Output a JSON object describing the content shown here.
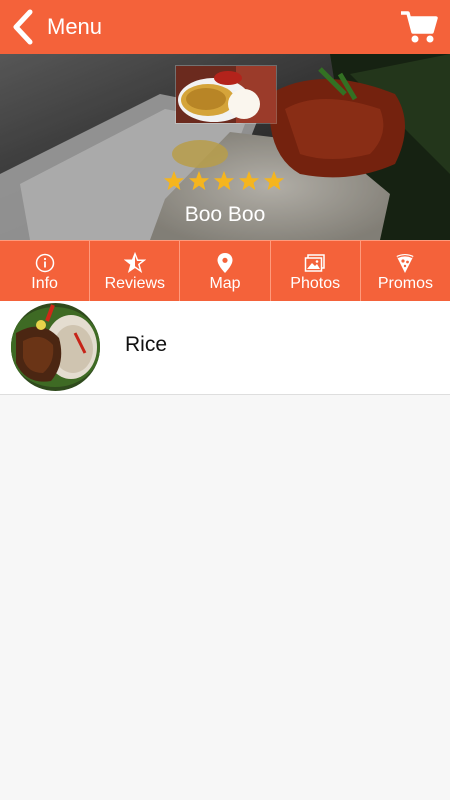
{
  "header": {
    "title": "Menu",
    "back_icon": "chevron-left-icon",
    "cart_icon": "shopping-cart-icon",
    "accent_color": "#f4623a"
  },
  "restaurant": {
    "name": "Boo Boo",
    "rating": 5,
    "rating_max": 5
  },
  "tabs": [
    {
      "label": "Info",
      "icon": "info-icon"
    },
    {
      "label": "Reviews",
      "icon": "star-half-icon"
    },
    {
      "label": "Map",
      "icon": "map-pin-icon"
    },
    {
      "label": "Photos",
      "icon": "photos-icon"
    },
    {
      "label": "Promos",
      "icon": "pizza-icon"
    }
  ],
  "menu_items": [
    {
      "label": "Rice"
    }
  ]
}
